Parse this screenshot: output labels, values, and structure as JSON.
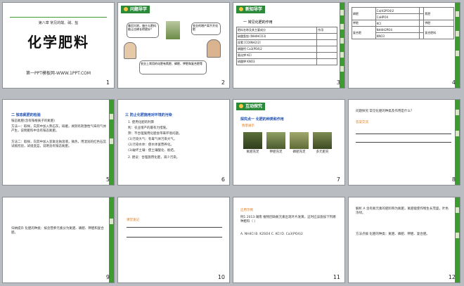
{
  "slides": [
    {
      "num": "1",
      "subtitle": "第八章 常见的酸、碱、盐",
      "title": "化学肥料",
      "footer": "第一PPT模板网-WWW.1PPT.COM"
    },
    {
      "num": "2",
      "header": "问题导学",
      "bubble1": "春回大地，施什么肥料能让庄稼长得更好？",
      "bubble2": "农业的增产离不开化肥",
      "bubble3": "农业上常用的化肥有氮肥、磷肥、钾肥和复合肥等"
    },
    {
      "num": "3",
      "header": "新知导学",
      "section": "一 常见化肥的作用",
      "col1": "肥料名称及其主要成分",
      "col2": "作用",
      "rows": [
        "碳酸氢铵 (NH4HCO3)",
        "尿素 [CO(NH2)2]",
        "磷酸钙 Ca3(PO4)2",
        "氯化钾 KCl",
        "硝酸钾 KNO3"
      ]
    },
    {
      "num": "4",
      "col1": "磷肥",
      "col2": "钾肥",
      "col3": "复合肥",
      "t1": "氮肥",
      "t2": "钾肥",
      "t3": "复合肥料"
    },
    {
      "num": "5",
      "section": "二 铵态氮肥的检验",
      "line1": "铵态氮肥(含有铵根离子的氮肥)",
      "line2": "方法一：取样，向其中加入熟石灰，研磨，闻到有刺激性气味的气体产生，说明肥料中含有铵态氮肥。",
      "line3": "方法二：取样，向其中加入氢氧化钠溶液，微热，用湿润的红色石蕊试纸检验，试纸变蓝，说明含有铵态氮肥。"
    },
    {
      "num": "6",
      "section": "三 防止化肥施用对环境的污染",
      "lines": [
        "1. 使用化肥的利弊",
        "利：农业增产的最有力措施。",
        "弊：不合理施用化肥会带来环境问题。",
        "(1)污染大气：有毒气体污染大气。",
        "(2)污染水体：使水体富营养化。",
        "(3)破坏土壤：使土壤酸化、板结。",
        "2. 建议：合理施用化肥，减少污染。"
      ]
    },
    {
      "num": "7",
      "header": "互动探究",
      "section": "探究点一 化肥的种类和作用",
      "tag": "情景展示",
      "captions": [
        "氮肥充足",
        "钾肥充足",
        "磷肥充足",
        "多元肥充"
      ]
    },
    {
      "num": "8",
      "question": "问题探究 常见化肥的种类及作用是什么？",
      "answer": "答案交流"
    },
    {
      "num": "9",
      "text": "归纳提升 化肥的种类：按含营养元素分为氮肥、磷肥、钾肥和复合肥。"
    },
    {
      "num": "10",
      "tag": "课堂速记"
    },
    {
      "num": "11",
      "tag": "应用示例",
      "q": "例1 2013·湖南 植物因缺氮元素出现叶片发黄，这时应该施加下列哪种肥料（ ）",
      "options": "A. NH4Cl  B. K2SO4  C. KCl  D. Ca3(PO4)2"
    },
    {
      "num": "12",
      "explain": "解析 A 含有氮元素的肥料称为氮肥，氮肥能使作物生长茂盛，叶色浓绿。",
      "method": "方法点拨 化肥的种类：氮肥、磷肥、钾肥、复合肥。"
    }
  ],
  "colors": {
    "green": "#2a8a3a",
    "red": "#d21a1a",
    "orange": "#e07a16"
  }
}
